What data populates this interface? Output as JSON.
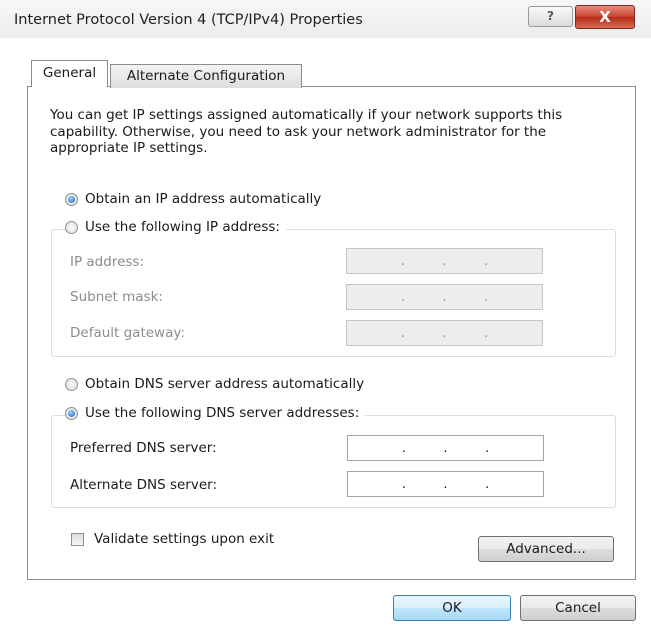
{
  "window": {
    "title": "Internet Protocol Version 4 (TCP/IPv4) Properties",
    "help_glyph": "?",
    "close_glyph": "X"
  },
  "tabs": [
    {
      "label": "General",
      "selected": true
    },
    {
      "label": "Alternate Configuration",
      "selected": false
    }
  ],
  "intro_text": "You can get IP settings assigned automatically if your network supports this capability. Otherwise, you need to ask your network administrator for the appropriate IP settings.",
  "ip_section": {
    "auto_label": "Obtain an IP address automatically",
    "auto_selected": true,
    "manual_label": "Use the following IP address:",
    "manual_selected": false,
    "fields": [
      {
        "label": "IP address:",
        "value": ".   .   .",
        "enabled": false
      },
      {
        "label": "Subnet mask:",
        "value": ".   .   .",
        "enabled": false
      },
      {
        "label": "Default gateway:",
        "value": ".   .   .",
        "enabled": false
      }
    ]
  },
  "dns_section": {
    "auto_label": "Obtain DNS server address automatically",
    "auto_selected": false,
    "manual_label": "Use the following DNS server addresses:",
    "manual_selected": true,
    "fields": [
      {
        "label": "Preferred DNS server:",
        "value": ".   .   .",
        "enabled": true
      },
      {
        "label": "Alternate DNS server:",
        "value": ".   .   .",
        "enabled": true
      }
    ]
  },
  "validate": {
    "label": "Validate settings upon exit",
    "checked": false
  },
  "buttons": {
    "advanced": "Advanced...",
    "ok": "OK",
    "cancel": "Cancel"
  }
}
